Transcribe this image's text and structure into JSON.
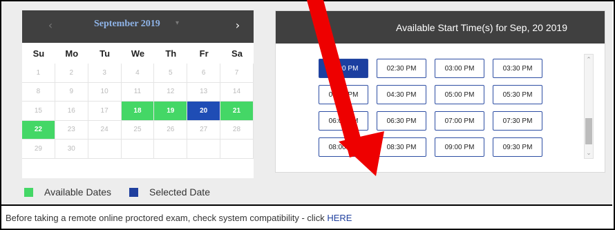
{
  "calendar": {
    "month_label": "September 2019",
    "prev_icon": "‹",
    "next_icon": "›",
    "caret_icon": "▾",
    "weekdays": [
      "Su",
      "Mo",
      "Tu",
      "We",
      "Th",
      "Fr",
      "Sa"
    ],
    "cells": [
      {
        "day": "1",
        "state": "disabled"
      },
      {
        "day": "2",
        "state": "disabled"
      },
      {
        "day": "3",
        "state": "disabled"
      },
      {
        "day": "4",
        "state": "disabled"
      },
      {
        "day": "5",
        "state": "disabled"
      },
      {
        "day": "6",
        "state": "disabled"
      },
      {
        "day": "7",
        "state": "disabled"
      },
      {
        "day": "8",
        "state": "disabled"
      },
      {
        "day": "9",
        "state": "disabled"
      },
      {
        "day": "10",
        "state": "disabled"
      },
      {
        "day": "11",
        "state": "disabled"
      },
      {
        "day": "12",
        "state": "disabled"
      },
      {
        "day": "13",
        "state": "disabled"
      },
      {
        "day": "14",
        "state": "disabled"
      },
      {
        "day": "15",
        "state": "disabled"
      },
      {
        "day": "16",
        "state": "disabled"
      },
      {
        "day": "17",
        "state": "disabled"
      },
      {
        "day": "18",
        "state": "available"
      },
      {
        "day": "19",
        "state": "available"
      },
      {
        "day": "20",
        "state": "selected"
      },
      {
        "day": "21",
        "state": "available"
      },
      {
        "day": "22",
        "state": "available"
      },
      {
        "day": "23",
        "state": "disabled"
      },
      {
        "day": "24",
        "state": "disabled"
      },
      {
        "day": "25",
        "state": "disabled"
      },
      {
        "day": "26",
        "state": "disabled"
      },
      {
        "day": "27",
        "state": "disabled"
      },
      {
        "day": "28",
        "state": "disabled"
      },
      {
        "day": "29",
        "state": "disabled"
      },
      {
        "day": "30",
        "state": "disabled"
      },
      {
        "day": "",
        "state": "empty"
      },
      {
        "day": "",
        "state": "empty"
      },
      {
        "day": "",
        "state": "empty"
      },
      {
        "day": "",
        "state": "empty"
      },
      {
        "day": "",
        "state": "empty"
      }
    ]
  },
  "legend": {
    "available_label": "Available Dates",
    "selected_label": "Selected Date"
  },
  "times": {
    "header": "Available Start Time(s) for Sep, 20 2019",
    "slots": [
      {
        "label": "02:00 PM",
        "active": true
      },
      {
        "label": "02:30 PM",
        "active": false
      },
      {
        "label": "03:00 PM",
        "active": false
      },
      {
        "label": "03:30 PM",
        "active": false
      },
      {
        "label": "04:00 PM",
        "active": false
      },
      {
        "label": "04:30 PM",
        "active": false
      },
      {
        "label": "05:00 PM",
        "active": false
      },
      {
        "label": "05:30 PM",
        "active": false
      },
      {
        "label": "06:00 PM",
        "active": false
      },
      {
        "label": "06:30 PM",
        "active": false
      },
      {
        "label": "07:00 PM",
        "active": false
      },
      {
        "label": "07:30 PM",
        "active": false
      },
      {
        "label": "08:00 PM",
        "active": false
      },
      {
        "label": "08:30 PM",
        "active": false
      },
      {
        "label": "09:00 PM",
        "active": false
      },
      {
        "label": "09:30 PM",
        "active": false
      }
    ],
    "scroll_up_icon": "⌃",
    "scroll_down_icon": "⌄"
  },
  "footer": {
    "text": "Before taking a remote online proctored exam, check system compatibility - click ",
    "link": "HERE"
  },
  "colors": {
    "available": "#44d766",
    "selected": "#1f4db5",
    "header_bg": "#404040",
    "arrow": "#ee0000"
  }
}
